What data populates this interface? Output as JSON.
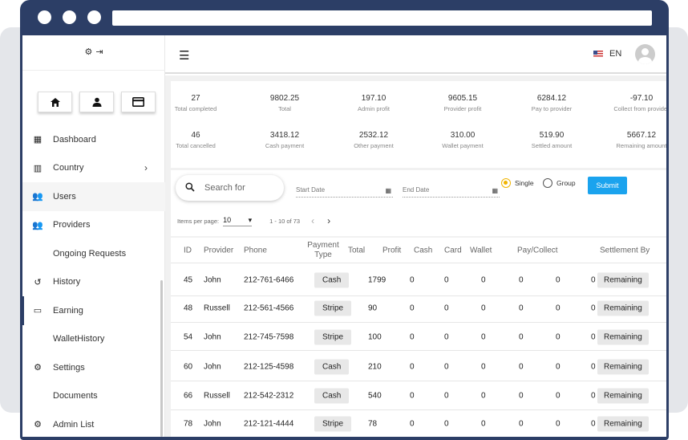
{
  "sidebar": {
    "top_icons": [
      "gear-icon",
      "logout-icon"
    ],
    "quick_icons": [
      "home-icon",
      "person-icon",
      "card-icon"
    ],
    "items": [
      {
        "label": "Dashboard",
        "icon": "dashboard-icon",
        "glyph": "▦",
        "chev": ""
      },
      {
        "label": "Country",
        "icon": "building-icon",
        "glyph": "▥",
        "chev": "›"
      },
      {
        "label": "Users",
        "icon": "group-icon",
        "glyph": "👥",
        "chev": ""
      },
      {
        "label": "Providers",
        "icon": "group-icon",
        "glyph": "👥",
        "chev": ""
      },
      {
        "label": "Ongoing Requests",
        "icon": "",
        "glyph": "",
        "chev": ""
      },
      {
        "label": "History",
        "icon": "history-icon",
        "glyph": "↺",
        "chev": ""
      },
      {
        "label": "Earning",
        "icon": "card-icon",
        "glyph": "▭",
        "chev": ""
      },
      {
        "label": "WalletHistory",
        "icon": "",
        "glyph": "",
        "chev": ""
      },
      {
        "label": "Settings",
        "icon": "gear-icon",
        "glyph": "⚙",
        "chev": ""
      },
      {
        "label": "Documents",
        "icon": "",
        "glyph": "",
        "chev": ""
      },
      {
        "label": "Admin List",
        "icon": "gear-icon",
        "glyph": "⚙",
        "chev": ""
      }
    ]
  },
  "topbar": {
    "lang": "EN"
  },
  "stats": [
    {
      "value": "27",
      "label": "Total completed"
    },
    {
      "value": "9802.25",
      "label": "Total"
    },
    {
      "value": "197.10",
      "label": "Admin profit"
    },
    {
      "value": "9605.15",
      "label": "Provider profit"
    },
    {
      "value": "6284.12",
      "label": "Pay to provider"
    },
    {
      "value": "-97.10",
      "label": "Collect from provider"
    },
    {
      "value": "46",
      "label": "Total cancelled"
    },
    {
      "value": "3418.12",
      "label": "Cash payment"
    },
    {
      "value": "2532.12",
      "label": "Other payment"
    },
    {
      "value": "310.00",
      "label": "Wallet payment"
    },
    {
      "value": "519.90",
      "label": "Settled amount"
    },
    {
      "value": "5667.12",
      "label": "Remaining amount"
    }
  ],
  "filters": {
    "search_placeholder": "Search for",
    "start_date": "Start Date",
    "end_date": "End Date",
    "radio_single": "Single",
    "radio_group": "Group",
    "submit": "Submit",
    "items_per_page_label": "Items per page:",
    "items_per_page": "10",
    "range": "1 - 10 of 73"
  },
  "table": {
    "headers": [
      "ID",
      "Provider",
      "Phone",
      "Payment Type",
      "Total",
      "Profit",
      "Cash",
      "Card",
      "Wallet",
      "Pay/Collect",
      "Settlement By"
    ],
    "rows": [
      {
        "id": "45",
        "provider": "John",
        "phone": "212-761-6466",
        "type": "Cash",
        "total": "1799",
        "profit": "0",
        "cash": "0",
        "card": "0",
        "wallet": "0",
        "pay": "0",
        "collect": "0",
        "settle": "Remaining"
      },
      {
        "id": "48",
        "provider": "Russell",
        "phone": "212-561-4566",
        "type": "Stripe",
        "total": "90",
        "profit": "0",
        "cash": "0",
        "card": "0",
        "wallet": "0",
        "pay": "0",
        "collect": "0",
        "settle": "Remaining"
      },
      {
        "id": "54",
        "provider": "John",
        "phone": "212-745-7598",
        "type": "Stripe",
        "total": "100",
        "profit": "0",
        "cash": "0",
        "card": "0",
        "wallet": "0",
        "pay": "0",
        "collect": "0",
        "settle": "Remaining"
      },
      {
        "id": "60",
        "provider": "John",
        "phone": "212-125-4598",
        "type": "Cash",
        "total": "210",
        "profit": "0",
        "cash": "0",
        "card": "0",
        "wallet": "0",
        "pay": "0",
        "collect": "0",
        "settle": "Remaining"
      },
      {
        "id": "66",
        "provider": "Russell",
        "phone": "212-542-2312",
        "type": "Cash",
        "total": "540",
        "profit": "0",
        "cash": "0",
        "card": "0",
        "wallet": "0",
        "pay": "0",
        "collect": "0",
        "settle": "Remaining"
      },
      {
        "id": "78",
        "provider": "John",
        "phone": "212-121-4444",
        "type": "Stripe",
        "total": "78",
        "profit": "0",
        "cash": "0",
        "card": "0",
        "wallet": "0",
        "pay": "0",
        "collect": "0",
        "settle": "Remaining"
      }
    ]
  },
  "colors": {
    "frame": "#2c3e66",
    "submit": "#1aa3ee",
    "radio_on": "#f0b400"
  }
}
